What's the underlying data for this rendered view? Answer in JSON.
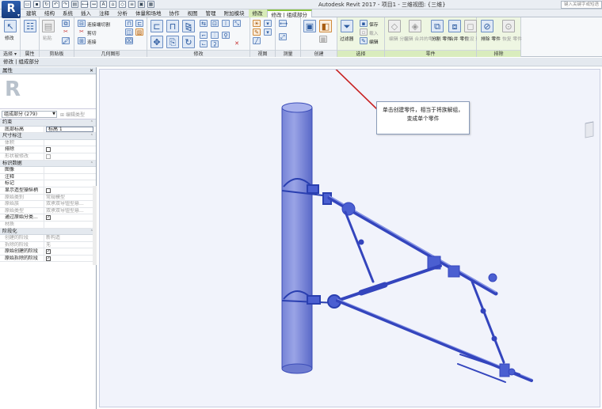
{
  "app": {
    "logo_letter": "R",
    "window_title": "Autodesk Revit 2017 -   项目1 - 三维视图: {三维}",
    "search_placeholder": "键入关键字或短语"
  },
  "tabs": [
    {
      "label": "建筑"
    },
    {
      "label": "结构"
    },
    {
      "label": "系统"
    },
    {
      "label": "插入"
    },
    {
      "label": "注释"
    },
    {
      "label": "分析"
    },
    {
      "label": "体量和场地"
    },
    {
      "label": "协作"
    },
    {
      "label": "视图"
    },
    {
      "label": "管理"
    },
    {
      "label": "附加模块"
    },
    {
      "label": "修改"
    },
    {
      "label": "修改 | 组成部分"
    }
  ],
  "ribbon": {
    "panels": {
      "select": "选择 ▾",
      "properties": "属性",
      "clipboard": "剪贴板",
      "geometry": "几何图形",
      "modify": "修改",
      "view": "视图",
      "measure": "测量",
      "create": "创建",
      "selection": "选择",
      "parts": "零件",
      "exclude": "排除"
    },
    "buttons": {
      "modify": "修改",
      "paste": "粘贴",
      "cope": "连接端切割",
      "cut": "剪切",
      "join": "连接",
      "filter": "过滤器",
      "save": "保存",
      "load": "载入",
      "edit": "编辑",
      "edit_part": "编辑\n分区",
      "edit_merged": "编辑\n合并的零件",
      "divide": "分割\n零件",
      "merge": "合并\n零件",
      "restore": "重设\n形状",
      "exclude": "排除\n零件",
      "restore_parts": "恢复\n零件"
    }
  },
  "breadcrumb": "修改 | 组成部分",
  "properties": {
    "title": "属性",
    "close": "✕",
    "type_selector": "组成部分 (279)",
    "edit_type": "编辑类型",
    "categories": [
      {
        "label": "约束",
        "rows": [
          {
            "name": "底部标高",
            "value": "标高 1",
            "kind": "input"
          }
        ]
      },
      {
        "label": "尺寸标注",
        "rows": [
          {
            "name": "体积",
            "value": "",
            "dis": true
          },
          {
            "name": "排除",
            "value": "",
            "kind": "check"
          },
          {
            "name": "形状被修改",
            "value": "",
            "kind": "check",
            "dis": true
          }
        ]
      },
      {
        "label": "标识数据",
        "rows": [
          {
            "name": "图像",
            "value": ""
          },
          {
            "name": "注释",
            "value": ""
          },
          {
            "name": "标记",
            "value": ""
          },
          {
            "name": "显示造型操纵柄",
            "value": "",
            "kind": "check"
          },
          {
            "name": "原始类别",
            "value": "常规模型",
            "dis": true
          },
          {
            "name": "原始族",
            "value": "双承双导钮型悬...",
            "dis": true
          },
          {
            "name": "原始类型",
            "value": "双承双导钮型悬...",
            "dis": true
          },
          {
            "name": "通过原始分类...",
            "value": "",
            "kind": "check",
            "checked": true
          },
          {
            "name": "材质",
            "value": "",
            "dis": true
          }
        ]
      },
      {
        "label": "阶段化",
        "rows": [
          {
            "name": "创建的阶段",
            "value": "新构造",
            "dis": true
          },
          {
            "name": "拆除的阶段",
            "value": "无",
            "dis": true
          },
          {
            "name": "原始创建的阶段",
            "value": "",
            "kind": "check",
            "checked": true
          },
          {
            "name": "原始拆除的阶段",
            "value": "",
            "kind": "check",
            "checked": true
          }
        ]
      }
    ]
  },
  "canvas": {
    "callout": "单击创建零件，相当于将族解组，变成单个零件",
    "model_color": "#4659c4"
  }
}
